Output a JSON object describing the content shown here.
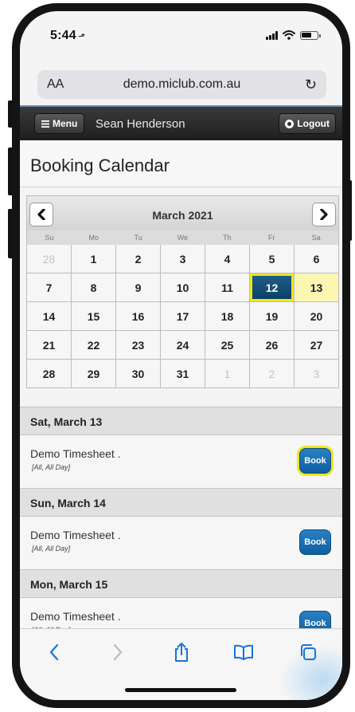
{
  "status": {
    "time": "5:44",
    "location_glyph": "⬏"
  },
  "browser": {
    "aa_label": "AA",
    "url": "demo.miclub.com.au",
    "reload_glyph": "↻"
  },
  "header": {
    "menu_label": "Menu",
    "user_name": "Sean Henderson",
    "logout_label": "Logout"
  },
  "page_title": "Booking Calendar",
  "calendar": {
    "month_label": "March 2021",
    "weekdays": [
      "Su",
      "Mo",
      "Tu",
      "We",
      "Th",
      "Fr",
      "Sa"
    ],
    "weeks": [
      [
        "28",
        "1",
        "2",
        "3",
        "4",
        "5",
        "6"
      ],
      [
        "7",
        "8",
        "9",
        "10",
        "11",
        "12",
        "13"
      ],
      [
        "14",
        "15",
        "16",
        "17",
        "18",
        "19",
        "20"
      ],
      [
        "21",
        "22",
        "23",
        "24",
        "25",
        "26",
        "27"
      ],
      [
        "28",
        "29",
        "30",
        "31",
        "1",
        "2",
        "3"
      ]
    ],
    "today": "12",
    "selected": "13"
  },
  "days": [
    {
      "heading": "Sat, March 13",
      "event_title": "Demo Timesheet .",
      "event_sub": "[All, All Day]",
      "book_label": "Book"
    },
    {
      "heading": "Sun, March 14",
      "event_title": "Demo Timesheet .",
      "event_sub": "[All, All Day]",
      "book_label": "Book"
    },
    {
      "heading": "Mon, March 15",
      "event_title": "Demo Timesheet .",
      "event_sub": "[All, All Day]",
      "book_label": "Book"
    }
  ],
  "colors": {
    "header_bg": "#262626",
    "today_bg": "#0f4a74",
    "highlight": "#f0e51c",
    "selected_bg": "#fbf7b2",
    "book_bg": "#1a6fb3"
  }
}
